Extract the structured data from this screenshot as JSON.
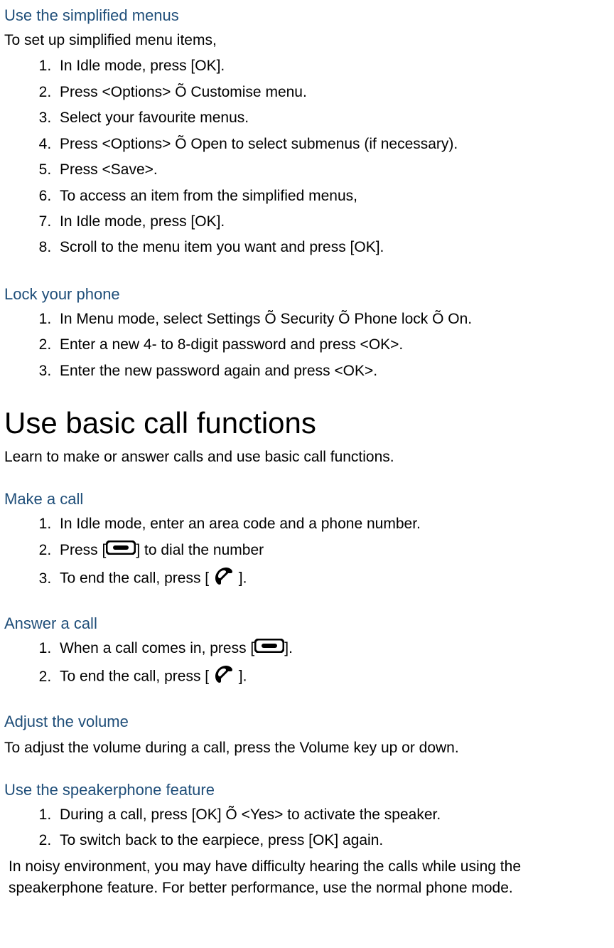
{
  "sec1": {
    "title": "Use the simplified menus",
    "intro": "To set up simplified menu items,",
    "steps": [
      "In Idle mode, press [OK].",
      "Press <Options> Õ Customise menu.",
      "Select your favourite menus.",
      "Press <Options> Õ Open to select submenus (if necessary).",
      "Press <Save>.",
      "To access an item from the simplified menus,",
      "In Idle mode, press [OK].",
      "Scroll to the menu item you want and press [OK]."
    ]
  },
  "sec2": {
    "title": "Lock your phone",
    "steps": [
      "In Menu mode, select Settings Õ Security Õ Phone lock Õ On.",
      "Enter a new 4- to 8-digit password and press <OK>.",
      "Enter the new password again and press <OK>."
    ]
  },
  "sec3": {
    "title": "Use basic call functions",
    "intro": "Learn to make or answer calls and use basic call functions."
  },
  "sec4": {
    "title": "Make a call",
    "step1": "In Idle mode, enter an area code and a phone number.",
    "step2a": "Press [",
    "step2b": "] to dial the number",
    "step3a": "To end the call, press [ ",
    "step3b": " ]."
  },
  "sec5": {
    "title": "Answer a call",
    "step1a": "When a call comes in, press [",
    "step1b": "].",
    "step2a": "To end the call, press [ ",
    "step2b": " ]."
  },
  "sec6": {
    "title": "Adjust the volume",
    "text": "To adjust the volume during a call, press the Volume key up or down."
  },
  "sec7": {
    "title": "Use the speakerphone feature",
    "step1": "During a call, press [OK] Õ <Yes> to activate the speaker.",
    "step2": "To switch back to the earpiece, press [OK] again.",
    "note": "In noisy environment, you may have difficulty hearing the calls while using the speakerphone feature. For better performance, use the normal phone mode."
  }
}
